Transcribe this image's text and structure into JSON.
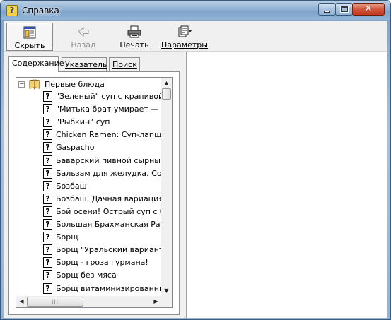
{
  "window": {
    "title": "Справка",
    "title_icon": "help-book-icon",
    "controls": {
      "minimize": "minimize-icon",
      "maximize": "maximize-icon",
      "close": "close-icon"
    }
  },
  "toolbar": {
    "hide": {
      "label": "Скрыть",
      "icon": "hide-pane-icon"
    },
    "back": {
      "label": "Назад",
      "icon": "back-arrow-icon",
      "enabled": false
    },
    "print": {
      "label": "Печать",
      "icon": "printer-icon"
    },
    "options": {
      "label": "Параметры",
      "icon": "options-icon"
    }
  },
  "tabs": [
    {
      "label": "Содержание",
      "active": true
    },
    {
      "label": "Указатель",
      "active": false
    },
    {
      "label": "Поиск",
      "active": false
    }
  ],
  "tree": {
    "root": {
      "label": "Первые блюда",
      "expanded": true,
      "icon": "open-book-icon"
    },
    "items": [
      "\"Зеленый\" суп с крапивой",
      "\"Митька брат умирает — у",
      "\"Рыбкин\" суп",
      "Chicken Ramen: Суп-лапша",
      "Gaspacho",
      "Баварский пивной сырный",
      "Бальзам для желудка. Соля",
      "Бозбаш",
      "Бозбаш. Дачная вариация :",
      "Бой осени! Острый суп с б",
      "Большая Брахманская Радо",
      "Борщ",
      "Борщ \"Уральский вариант",
      "Борщ - гроза гурмана!",
      "Борщ без мяса",
      "Борщ витаминизированны"
    ],
    "item_icon": "help-topic-icon"
  },
  "colors": {
    "titlebar": "#8eb0d3",
    "close_button": "#d2583c",
    "face": "#f0f0f0",
    "content": "#ffffff"
  }
}
